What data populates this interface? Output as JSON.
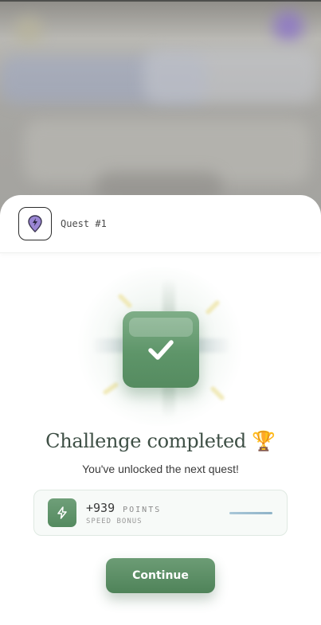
{
  "quest": {
    "label": "Quest #1",
    "icon": "lightning-pin-icon"
  },
  "celebration": {
    "badge_icon": "checkmark-icon"
  },
  "result": {
    "title": "Challenge completed 🏆",
    "subtitle": "You've unlocked the next quest!"
  },
  "reward": {
    "icon": "lightning-icon",
    "amount": "+939",
    "unit": "POINTS",
    "sub_label": "SPEED BONUS",
    "progress_percent": 100
  },
  "actions": {
    "continue_label": "Continue"
  },
  "colors": {
    "accent_green": "#5e9569",
    "title_color": "#3e4f45",
    "pin_purple": "#8b73c9"
  }
}
